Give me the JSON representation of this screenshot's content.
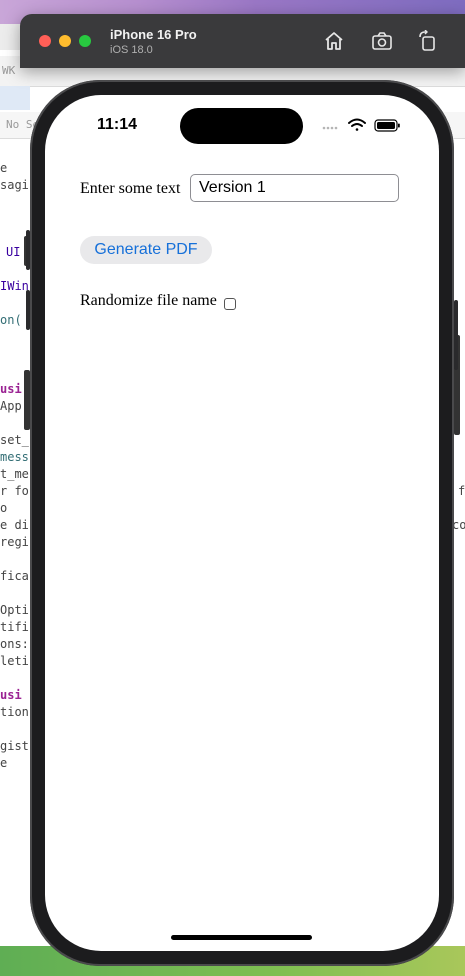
{
  "simulator": {
    "device_name": "iPhone 16 Pro",
    "os_version": "iOS 18.0"
  },
  "status_bar": {
    "time": "11:14"
  },
  "form": {
    "text_label": "Enter some text",
    "text_value": "Version 1",
    "generate_button_label": "Generate PDF",
    "randomize_label": "Randomize file name",
    "randomize_checked": false
  },
  "background_editor": {
    "search_placeholder": "No Se",
    "left_fragments": [
      "e",
      "sagi",
      "UI",
      "IWin",
      "on(",
      "usi",
      "App",
      "set_",
      "mess",
      "t_me",
      "r fo",
      "o",
      "e di",
      "regi",
      "fica",
      "Opti",
      "tifi",
      "ons:",
      "leti",
      "usi",
      "tion",
      "gist",
      "e"
    ],
    "right_fragments": [
      "f",
      "co"
    ],
    "top_fragment": "WK"
  },
  "colors": {
    "accent": "#1670d9",
    "window_header": "#3a3a3c",
    "close": "#ff5f57",
    "minimize": "#febc2e",
    "zoom": "#28c840"
  }
}
